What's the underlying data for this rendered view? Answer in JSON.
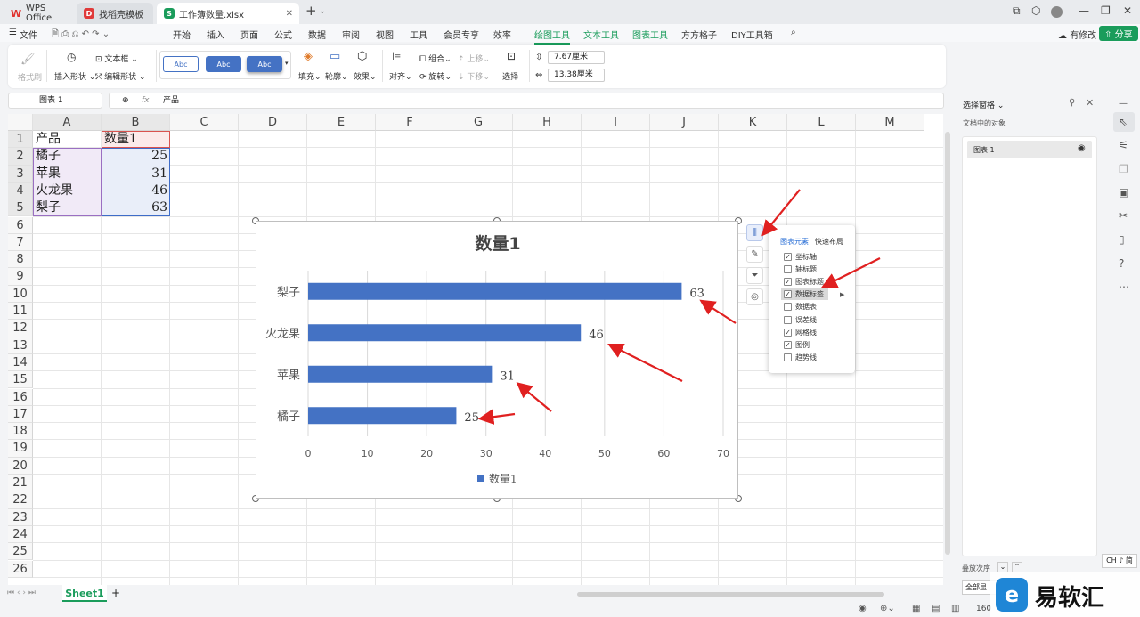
{
  "tabs": [
    {
      "label": "WPS Office",
      "icon": "wps-logo-icon"
    },
    {
      "label": "找稻壳模板",
      "icon": "docer-icon"
    },
    {
      "label": "工作簿数量.xlsx",
      "icon": "sheet-icon"
    }
  ],
  "menu": {
    "file": "文件",
    "items": [
      "开始",
      "插入",
      "页面",
      "公式",
      "数据",
      "审阅",
      "视图",
      "工具",
      "会员专享",
      "效率"
    ],
    "tools": [
      "绘图工具",
      "文本工具",
      "图表工具",
      "方方格子",
      "DIY工具箱"
    ],
    "has_modify": "有修改",
    "share": "分享"
  },
  "ribbon": {
    "format_brush": "格式刷",
    "insert_shape": "插入形状",
    "text_box": "文本框",
    "edit_shape": "编辑形状",
    "abc": "Abc",
    "fill": "填充",
    "outline": "轮廓",
    "effect": "效果",
    "align": "对齐",
    "group": "组合",
    "rotate": "旋转",
    "up": "上移",
    "down": "下移",
    "select": "选择",
    "height": "7.67厘米",
    "width": "13.38厘米"
  },
  "namebox": "图表 1",
  "fx": "fx",
  "formula": "产品",
  "columns": [
    "A",
    "B",
    "C",
    "D",
    "E",
    "F",
    "G",
    "H",
    "I",
    "J",
    "K",
    "L",
    "M"
  ],
  "rows": [
    "1",
    "2",
    "3",
    "4",
    "5",
    "6",
    "7",
    "8",
    "9",
    "10",
    "11",
    "12",
    "13",
    "14",
    "15",
    "16",
    "17",
    "18",
    "19",
    "20",
    "21",
    "22",
    "23",
    "24",
    "25",
    "26"
  ],
  "cells": {
    "A1": "产品",
    "B1": "数量1",
    "A2": "橘子",
    "B2": "25",
    "A3": "苹果",
    "B3": "31",
    "A4": "火龙果",
    "B4": "46",
    "A5": "梨子",
    "B5": "63"
  },
  "chart_data": {
    "type": "bar",
    "title": "数量1",
    "categories": [
      "橘子",
      "苹果",
      "火龙果",
      "梨子"
    ],
    "series": [
      {
        "name": "数量1",
        "values": [
          25,
          31,
          46,
          63
        ]
      }
    ],
    "xlim": [
      0,
      70
    ],
    "xticks": [
      "0",
      "10",
      "20",
      "30",
      "40",
      "50",
      "60",
      "70"
    ],
    "grid": true,
    "legend": "bottom",
    "bar_color": "#4472c4"
  },
  "popup": {
    "tab1": "图表元素",
    "tab2": "快速布局",
    "items": [
      {
        "label": "坐标轴",
        "checked": true
      },
      {
        "label": "轴标题",
        "checked": false
      },
      {
        "label": "图表标题",
        "checked": true
      },
      {
        "label": "数据标签",
        "checked": true
      },
      {
        "label": "数据表",
        "checked": false
      },
      {
        "label": "误差线",
        "checked": false
      },
      {
        "label": "网格线",
        "checked": true
      },
      {
        "label": "图例",
        "checked": true
      },
      {
        "label": "趋势线",
        "checked": false
      }
    ]
  },
  "panel": {
    "title": "选择窗格",
    "subtitle": "文档中的对象",
    "item": "图表 1",
    "order": "叠放次序",
    "show_all": "全部显"
  },
  "sheet_tab": "Sheet1",
  "ime": "CH ♪ 简",
  "zoom": "160",
  "watermark": "易软汇"
}
